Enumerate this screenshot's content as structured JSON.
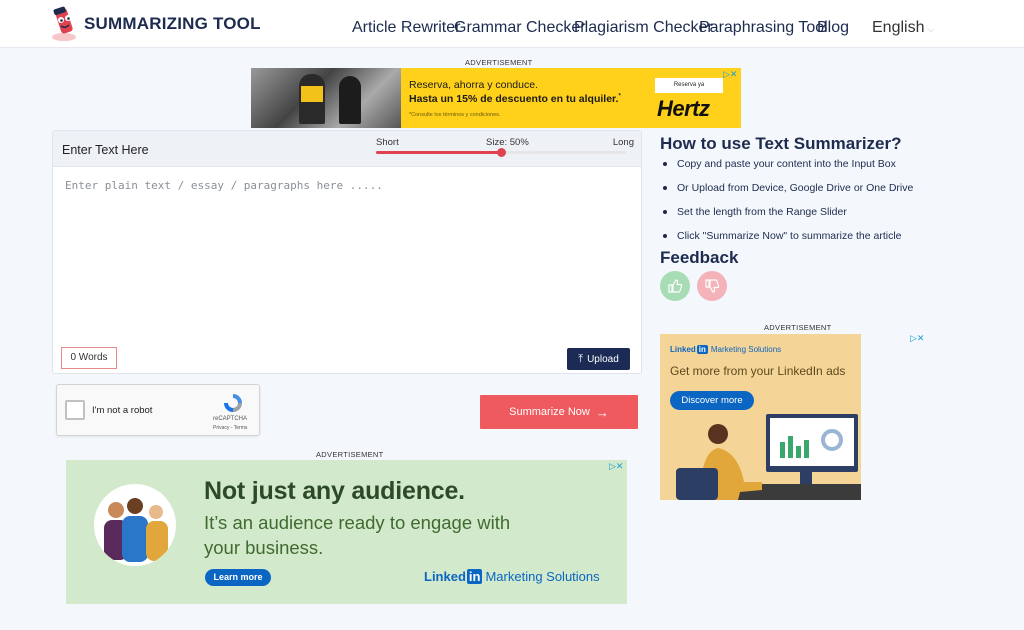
{
  "header": {
    "brand": "SUMMARIZING TOOL",
    "nav": [
      {
        "label": "Article Rewriter"
      },
      {
        "label": "Grammar Checker"
      },
      {
        "label": "Plagiarism Checker"
      },
      {
        "label": "Paraphrasing Tool"
      },
      {
        "label": "Blog"
      }
    ],
    "language": "English"
  },
  "ads": {
    "label": "ADVERTISEMENT",
    "top": {
      "line1": "Reserva, ahorra y conduce.",
      "line2": "Hasta un 15% de descuento en tu alquiler.",
      "line2_sup": "*",
      "fine_print": "*Consulte los términos y condiciones.",
      "cta": "Reserva ya",
      "brand": "Hertz"
    },
    "bottom": {
      "headline": "Not just any audience.",
      "subline": "It’s an audience ready to engage with your business.",
      "cta": "Learn more",
      "brand_word": "Linked",
      "brand_in": "in",
      "brand_suffix": "Marketing Solutions"
    },
    "right": {
      "brand_word": "Linked",
      "brand_in": "in",
      "brand_suffix": "Marketing Solutions",
      "headline": "Get more from your LinkedIn ads",
      "cta": "Discover more"
    },
    "close_glyph": "▷✕"
  },
  "editor": {
    "title": "Enter Text Here",
    "slider": {
      "min_label": "Short",
      "max_label": "Long",
      "size_label": "Size: 50%",
      "value": 50
    },
    "placeholder": "Enter plain text / essay / paragraphs here .....",
    "word_count": "0 Words",
    "upload_label": "Upload"
  },
  "captcha": {
    "label": "I'm not a robot",
    "brand": "reCAPTCHA",
    "links": "Privacy - Terms"
  },
  "summarize_label": "Summarize Now",
  "howto": {
    "title": "How to use Text Summarizer?",
    "steps": [
      "Copy and paste your content into the Input Box",
      "Or Upload from Device, Google Drive or One Drive",
      "Set the length from the Range Slider",
      "Click \"Summarize Now\" to summarize the article"
    ]
  },
  "feedback": {
    "title": "Feedback"
  },
  "colors": {
    "accent": "#ef5a5f",
    "navy": "#1d2b4f",
    "linkedin": "#0a66c2",
    "hertz": "#ffd11a"
  }
}
